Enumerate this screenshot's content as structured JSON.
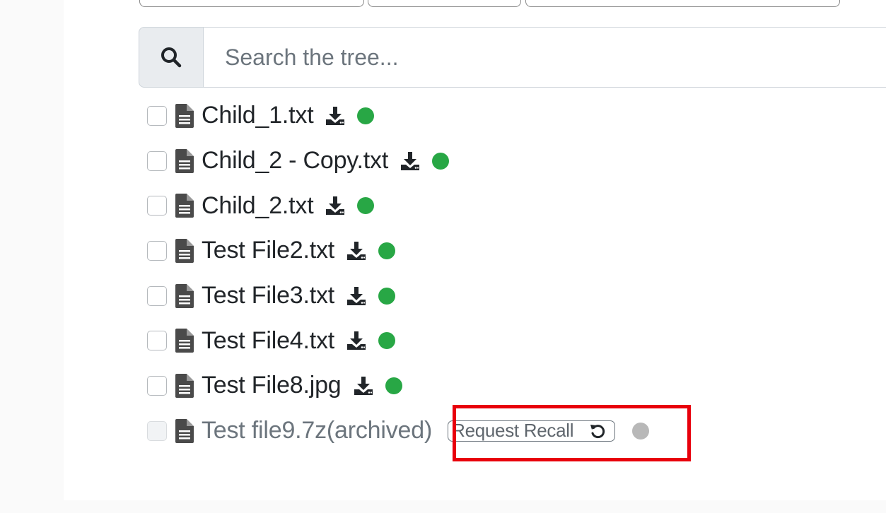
{
  "search": {
    "placeholder": "Search the tree...",
    "icon": "search-icon"
  },
  "tree": {
    "items": [
      {
        "name": "Child_1.txt",
        "status": "available",
        "status_color": "#28a745"
      },
      {
        "name": "Child_2 - Copy.txt",
        "status": "available",
        "status_color": "#28a745"
      },
      {
        "name": "Child_2.txt",
        "status": "available",
        "status_color": "#28a745"
      },
      {
        "name": "Test File2.txt",
        "status": "available",
        "status_color": "#28a745"
      },
      {
        "name": "Test File3.txt",
        "status": "available",
        "status_color": "#28a745"
      },
      {
        "name": "Test File4.txt",
        "status": "available",
        "status_color": "#28a745"
      },
      {
        "name": "Test File8.jpg",
        "status": "available",
        "status_color": "#28a745"
      },
      {
        "name": "Test file9.7z(archived)",
        "status": "archived",
        "status_color": "#b8b8b8",
        "action_label": "Request Recall",
        "action_icon": "undo-icon"
      }
    ]
  },
  "colors": {
    "available": "#28a745",
    "archived": "#b8b8b8",
    "highlight": "#e8000b",
    "text": "#212529",
    "muted_text": "#6c757d"
  }
}
